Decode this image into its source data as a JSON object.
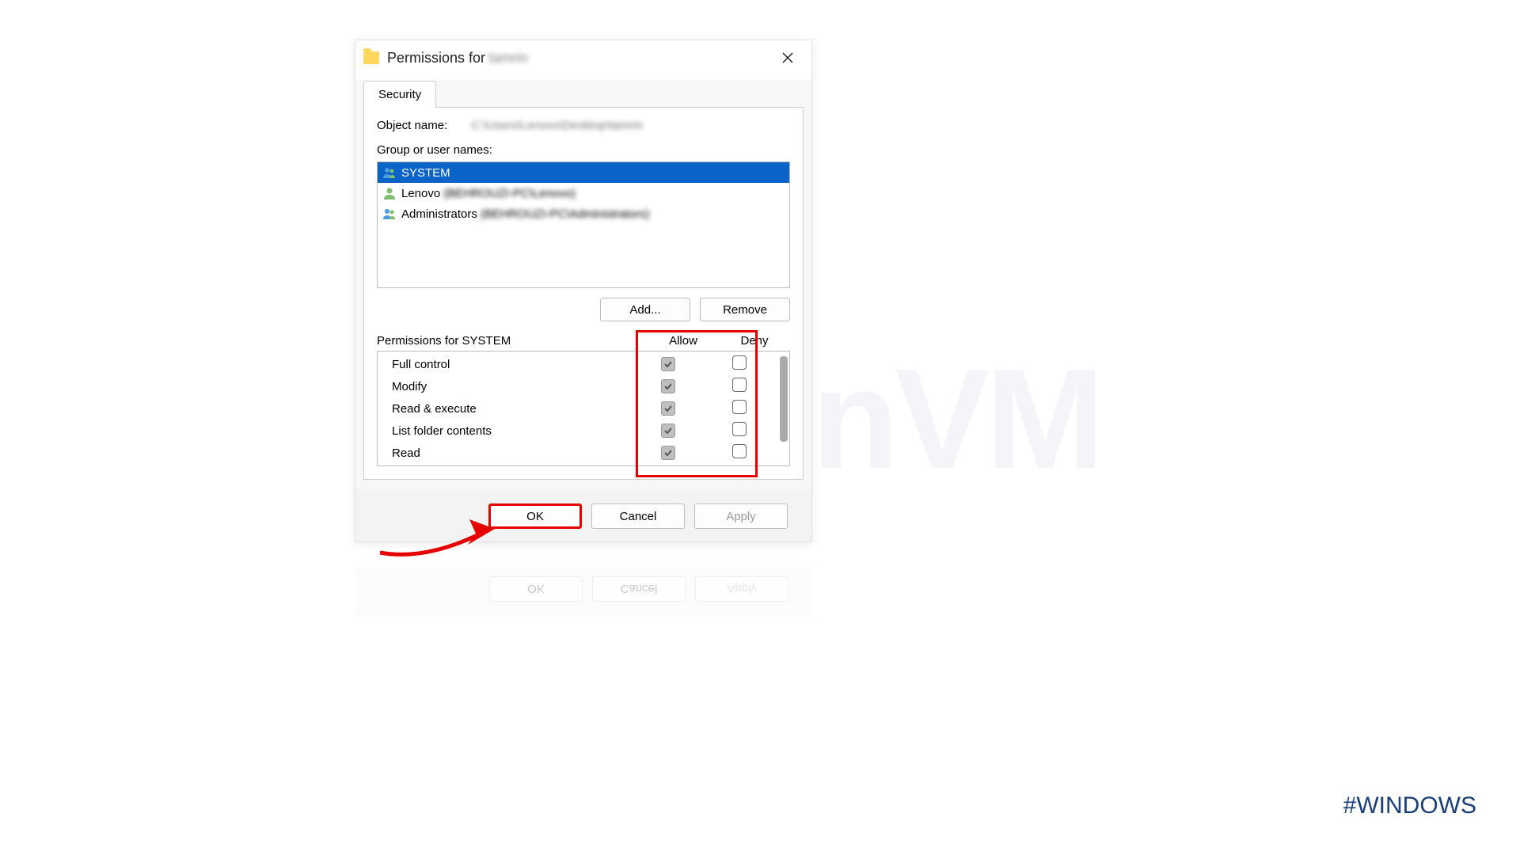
{
  "window": {
    "title_prefix": "Permissions for",
    "title_blurred": "tamrin"
  },
  "tab": {
    "security": "Security"
  },
  "object": {
    "label": "Object name:",
    "path_blurred": "C:\\Users\\Lenovo\\Desktop\\tamrin"
  },
  "group_label": "Group or user names:",
  "users": [
    {
      "name": "SYSTEM",
      "suffix": "",
      "selected": true,
      "icon": "group"
    },
    {
      "name": "Lenovo",
      "suffix": "(BEHROUZI-PC\\Lenovo)",
      "selected": false,
      "icon": "user"
    },
    {
      "name": "Administrators",
      "suffix": "(BEHROUZI-PC\\Administrators)",
      "selected": false,
      "icon": "group"
    }
  ],
  "buttons": {
    "add": "Add...",
    "remove": "Remove",
    "ok": "OK",
    "cancel": "Cancel",
    "apply": "Apply"
  },
  "perm_header": {
    "label": "Permissions for SYSTEM",
    "allow": "Allow",
    "deny": "Deny"
  },
  "permissions": [
    {
      "name": "Full control",
      "allow": true,
      "deny": false
    },
    {
      "name": "Modify",
      "allow": true,
      "deny": false
    },
    {
      "name": "Read & execute",
      "allow": true,
      "deny": false
    },
    {
      "name": "List folder contents",
      "allow": true,
      "deny": false
    },
    {
      "name": "Read",
      "allow": true,
      "deny": false
    }
  ],
  "watermark": "NeuronVM",
  "hashtag": "#WINDOWS"
}
